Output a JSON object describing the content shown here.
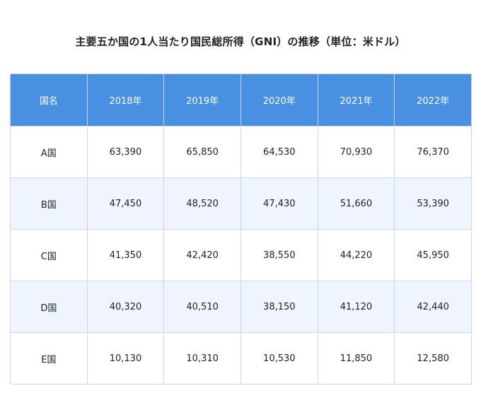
{
  "chart_data": {
    "type": "table",
    "title": "主要五か国の1人当たり国民総所得（GNI）の推移（単位：米ドル）",
    "columns": [
      "国名",
      "2018年",
      "2019年",
      "2020年",
      "2021年",
      "2022年"
    ],
    "rows": [
      {
        "label": "A国",
        "values": [
          "63,390",
          "65,850",
          "64,530",
          "70,930",
          "76,370"
        ]
      },
      {
        "label": "B国",
        "values": [
          "47,450",
          "48,520",
          "47,430",
          "51,660",
          "53,390"
        ]
      },
      {
        "label": "C国",
        "values": [
          "41,350",
          "42,420",
          "38,550",
          "44,220",
          "45,950"
        ]
      },
      {
        "label": "D国",
        "values": [
          "40,320",
          "40,510",
          "38,150",
          "41,120",
          "42,440"
        ]
      },
      {
        "label": "E国",
        "values": [
          "10,130",
          "10,310",
          "10,530",
          "11,850",
          "12,580"
        ]
      }
    ],
    "colors": {
      "header_bg": "#4a90e2",
      "header_text": "#ffffff",
      "stripe_bg": "#eef5fe",
      "border": "#d0d5de"
    }
  }
}
